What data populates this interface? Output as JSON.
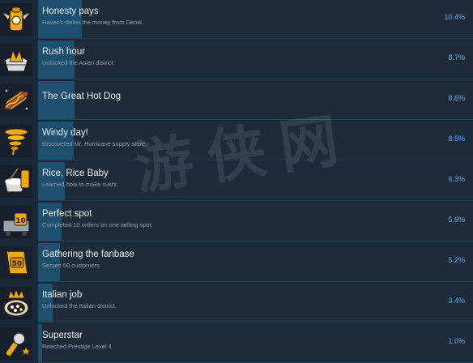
{
  "achievements": [
    {
      "title": "Honesty pays",
      "description": "Haven't stolen the money from Denis.",
      "percent_label": "10.4%",
      "percent": 10.4,
      "icon": "money-bag-icon"
    },
    {
      "title": "Rush hour",
      "description": "Unlocked the Asian district.",
      "percent_label": "8.7%",
      "percent": 8.7,
      "icon": "rush-hour-icon"
    },
    {
      "title": "The Great Hot Dog",
      "description": "",
      "percent_label": "8.6%",
      "percent": 8.6,
      "icon": "hot-dog-icon"
    },
    {
      "title": "Windy day!",
      "description": "Discovered Mr. Hurricane supply store.",
      "percent_label": "8.5%",
      "percent": 8.5,
      "icon": "tornado-icon"
    },
    {
      "title": "Rice, Rice Baby",
      "description": "Learned how to make sushi.",
      "percent_label": "6.3%",
      "percent": 6.3,
      "icon": "rice-bowl-icon"
    },
    {
      "title": "Perfect spot",
      "description": "Completed 10 orders on one selling spot.",
      "percent_label": "5.6%",
      "percent": 5.6,
      "icon": "stand-10-icon"
    },
    {
      "title": "Gathering the fanbase",
      "description": "Served 50 customers.",
      "percent_label": "5.2%",
      "percent": 5.2,
      "icon": "badge-50-icon"
    },
    {
      "title": "Italian job",
      "description": "Unlocked the Italian district.",
      "percent_label": "3.4%",
      "percent": 3.4,
      "icon": "pizza-crown-icon"
    },
    {
      "title": "Superstar",
      "description": "Reached Prestige Level 4",
      "percent_label": "1.0%",
      "percent": 1.0,
      "icon": "microphone-star-icon"
    }
  ],
  "watermark": "游侠网",
  "colors": {
    "background": "#1b2838",
    "bar": "#1e2c3a",
    "fill": "#1d4f6e",
    "percent": "#5aa9e6",
    "icon_gold": "#f0a818"
  }
}
